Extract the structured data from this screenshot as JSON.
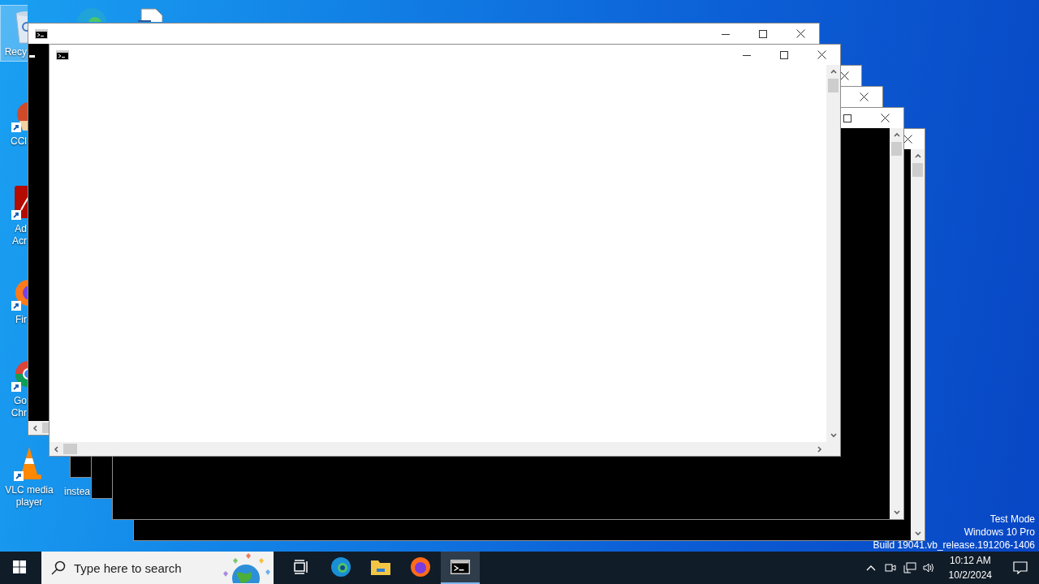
{
  "desktop_icons": [
    {
      "kind": "recycle-bin",
      "lines": [
        "Recy"
      ],
      "selected": true
    },
    {
      "kind": "ccleaner",
      "lines": [
        "CCl"
      ],
      "selected": false
    },
    {
      "kind": "acrobat",
      "lines": [
        "Ad",
        "Acr"
      ],
      "selected": false
    },
    {
      "kind": "firefox",
      "lines": [
        "Fir"
      ],
      "selected": false
    },
    {
      "kind": "chrome",
      "lines": [
        "Go",
        "Chr"
      ],
      "selected": false
    },
    {
      "kind": "vlc",
      "lines": [
        "VLC media",
        "player"
      ],
      "selected": false
    },
    {
      "kind": "edge",
      "selected": false
    },
    {
      "kind": "document",
      "selected": false
    },
    {
      "kind": "hidden",
      "lines": [
        "instea"
      ],
      "selected": false
    }
  ],
  "windows": [
    {
      "kind": "dark",
      "controls": [
        {
          "kind": "minimize"
        },
        {
          "kind": "maximize"
        },
        {
          "kind": "close"
        }
      ],
      "parts": [
        {
          "kind": "title-icon"
        },
        {
          "kind": "horizontal-scrollbar"
        },
        {
          "kind": "cursor"
        }
      ]
    },
    {
      "kind": "blank",
      "controls": [
        {
          "kind": "minimize"
        },
        {
          "kind": "maximize"
        },
        {
          "kind": "close"
        }
      ],
      "parts": [
        {
          "kind": "title-icon"
        },
        {
          "kind": "vertical-scrollbar"
        },
        {
          "kind": "horizontal-scrollbar"
        }
      ]
    },
    {
      "kind": "dark",
      "controls": [
        {
          "kind": "close"
        }
      ]
    },
    {
      "kind": "dark",
      "controls": [
        {
          "kind": "close"
        }
      ]
    },
    {
      "kind": "dark",
      "controls": [
        {
          "kind": "maximize"
        },
        {
          "kind": "close"
        }
      ],
      "parts": [
        {
          "kind": "vertical-scrollbar"
        }
      ]
    },
    {
      "kind": "dark",
      "controls": [
        {
          "kind": "close"
        }
      ],
      "parts": [
        {
          "kind": "vertical-scrollbar"
        }
      ]
    }
  ],
  "system_info": [
    "Test Mode",
    "Windows 10 Pro",
    "Build 19041.vb_release.191206-1406"
  ],
  "taskbar": {
    "search": {
      "placeholder": "Type here to search"
    },
    "apps": [
      {
        "kind": "task-view",
        "selected": false
      },
      {
        "kind": "edge",
        "selected": false
      },
      {
        "kind": "explorer",
        "selected": false
      },
      {
        "kind": "firefox",
        "selected": false
      },
      {
        "kind": "console",
        "selected": true
      }
    ],
    "time": "10:12 AM",
    "date": "10/2/2024"
  }
}
